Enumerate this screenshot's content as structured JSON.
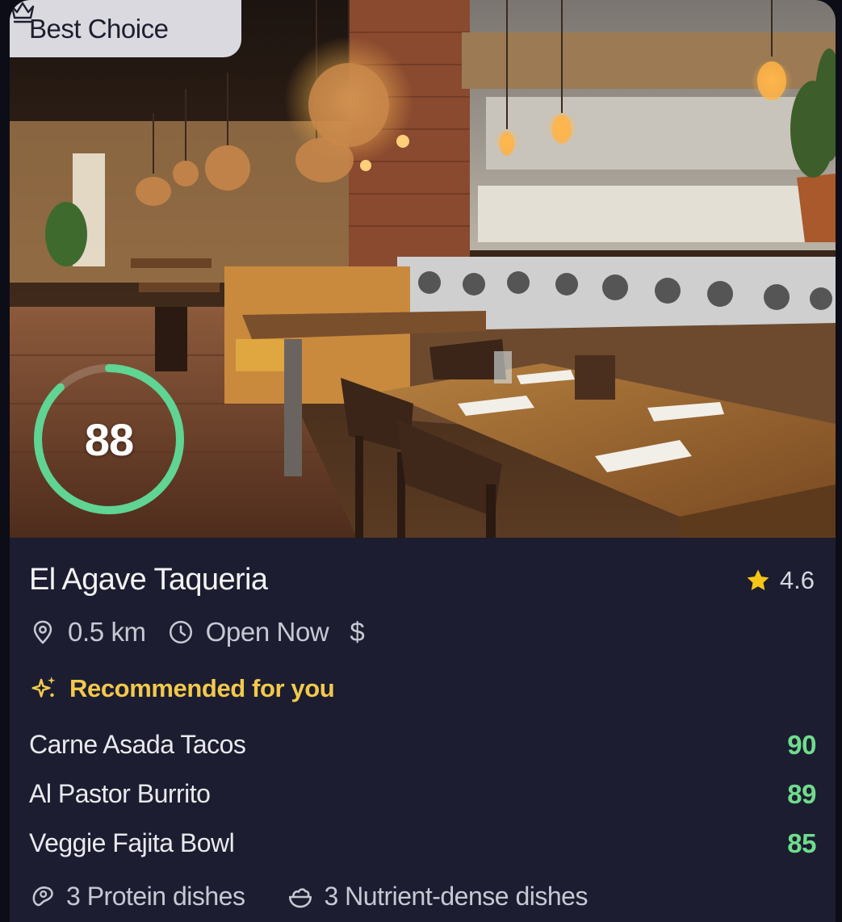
{
  "badge": {
    "label": "Best Choice",
    "icon": "crown-icon"
  },
  "score": {
    "value": "88",
    "fraction": 0.88,
    "color": "#5fd493"
  },
  "restaurant": {
    "name": "El Agave Taqueria",
    "rating": "4.6",
    "distance": "0.5 km",
    "status": "Open Now",
    "price": "$"
  },
  "recommended": {
    "title": "Recommended for you",
    "items": [
      {
        "name": "Carne Asada Tacos",
        "score": "90"
      },
      {
        "name": "Al Pastor Burrito",
        "score": "89"
      },
      {
        "name": "Veggie Fajita Bowl",
        "score": "85"
      }
    ]
  },
  "footer": {
    "protein": "3 Protein dishes",
    "nutrient": "3 Nutrient-dense dishes"
  },
  "colors": {
    "accent_yellow": "#f2c94c",
    "score_green": "#6fdc8c",
    "card_bg": "#1c1d30"
  }
}
